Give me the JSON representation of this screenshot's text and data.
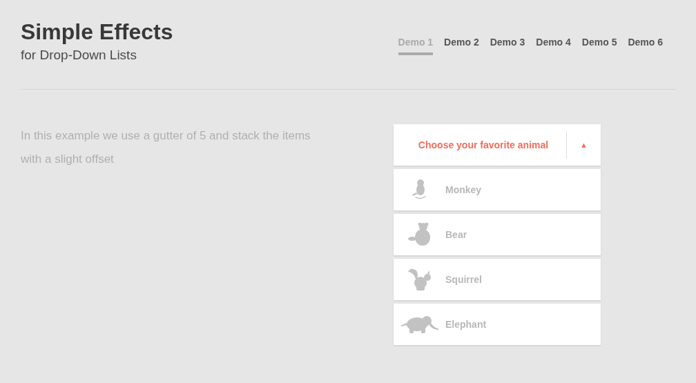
{
  "header": {
    "title": "Simple Effects",
    "subtitle": "for Drop-Down Lists"
  },
  "nav": [
    {
      "label": "Demo 1",
      "selected": true
    },
    {
      "label": "Demo 2",
      "selected": false
    },
    {
      "label": "Demo 3",
      "selected": false
    },
    {
      "label": "Demo 4",
      "selected": false
    },
    {
      "label": "Demo 5",
      "selected": false
    },
    {
      "label": "Demo 6",
      "selected": false
    }
  ],
  "description": "In this example we use a gutter of 5 and stack the items with a slight offset",
  "dropdown": {
    "label": "Choose your favorite animal",
    "toggle": "▲",
    "expanded": true,
    "options": [
      {
        "label": "Monkey",
        "kind": "monkey"
      },
      {
        "label": "Bear",
        "kind": "bear"
      },
      {
        "label": "Squirrel",
        "kind": "squirrel"
      },
      {
        "label": "Elephant",
        "kind": "elephant"
      }
    ]
  }
}
